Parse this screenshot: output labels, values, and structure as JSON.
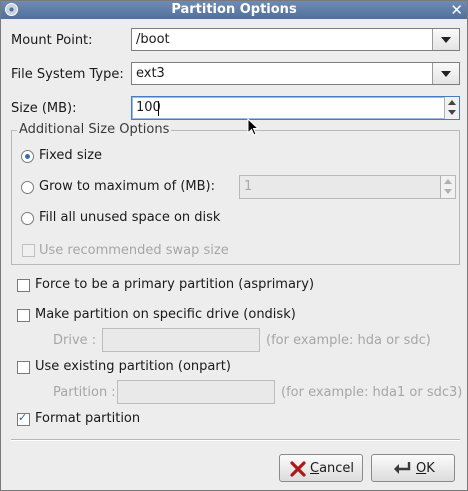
{
  "window": {
    "title": "Partition Options"
  },
  "fields": {
    "mount_point_label": "Mount Point:",
    "mount_point_value": "/boot",
    "fs_type_label": "File System Type:",
    "fs_type_value": "ext3",
    "size_label": "Size (MB):",
    "size_value": "100"
  },
  "size_options": {
    "title": "Additional Size Options",
    "fixed_label": "Fixed size",
    "fixed_selected": true,
    "grow_label": "Grow to maximum of (MB):",
    "grow_value": "1",
    "fill_label": "Fill all unused space on disk",
    "swap_label": "Use recommended swap size"
  },
  "options": {
    "primary_label": "Force to be a primary partition (asprimary)",
    "ondisk_label": "Make partition on specific drive (ondisk)",
    "drive_label": "Drive :",
    "drive_hint": "(for example: hda or sdc)",
    "onpart_label": "Use existing partition (onpart)",
    "partition_label": "Partition :",
    "partition_hint": "(for example: hda1 or sdc3)",
    "format_label": "Format partition",
    "format_checked": true
  },
  "buttons": {
    "cancel": "Cancel",
    "ok": "OK"
  }
}
